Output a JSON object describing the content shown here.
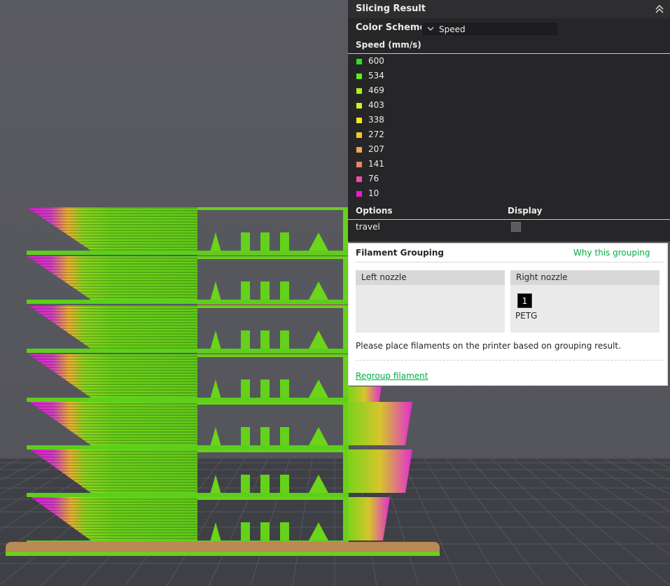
{
  "slicing_result": {
    "title": "Slicing Result",
    "color_scheme_label": "Color Scheme",
    "color_scheme_value": "Speed",
    "speed_heading": "Speed (mm/s)",
    "legend": [
      {
        "label": "600",
        "color": "#27e51a"
      },
      {
        "label": "534",
        "color": "#62ec19"
      },
      {
        "label": "469",
        "color": "#b0ee1a"
      },
      {
        "label": "403",
        "color": "#d9ee1d"
      },
      {
        "label": "338",
        "color": "#f3e915"
      },
      {
        "label": "272",
        "color": "#f6c52e"
      },
      {
        "label": "207",
        "color": "#f2a64f"
      },
      {
        "label": "141",
        "color": "#f0816c"
      },
      {
        "label": "76",
        "color": "#ef4eac"
      },
      {
        "label": "10",
        "color": "#e919d7"
      }
    ],
    "options_heading": "Options",
    "display_heading": "Display",
    "travel_label": "travel",
    "travel_checked": false
  },
  "filament_grouping": {
    "title": "Filament Grouping",
    "why_link": "Why this grouping",
    "left_nozzle": "Left nozzle",
    "right_nozzle": "Right nozzle",
    "filament_number": "1",
    "filament_name": "PETG",
    "note": "Please place filaments on the printer based on grouping result.",
    "regroup_link": "Regroup filament"
  },
  "colors": {
    "accent": "#00ae42",
    "viewport_bg": "#55565c",
    "panel_dark": "#262628",
    "bed": "#b88a54"
  }
}
